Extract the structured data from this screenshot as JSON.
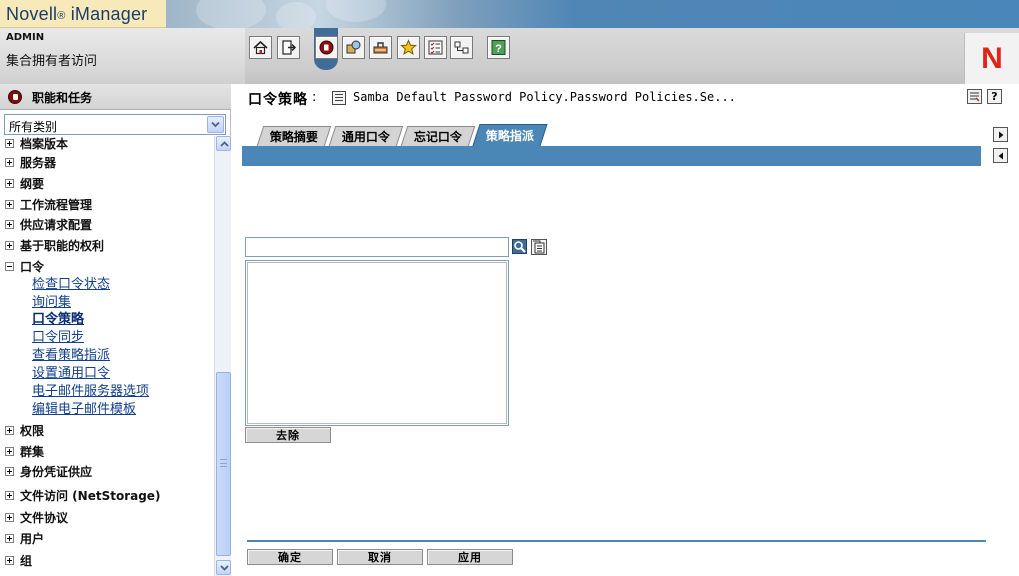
{
  "header": {
    "brand": "Novell",
    "brand_reg": "®",
    "product": " iManager",
    "user_name": "ADMIN",
    "user_role": "集合拥有者访问",
    "logo_letter": "N",
    "toolbar": [
      {
        "name": "home-icon"
      },
      {
        "name": "exit-icon"
      },
      {
        "name": "roles-tasks-icon"
      },
      {
        "name": "view-objects-icon"
      },
      {
        "name": "configure-icon"
      },
      {
        "name": "favorites-icon"
      },
      {
        "name": "preferences-icon"
      },
      {
        "name": "hierarchy-icon"
      },
      {
        "name": "help-icon"
      }
    ]
  },
  "sidebar": {
    "title": "职能和任务",
    "category_select": "所有类别",
    "categories_top": [
      {
        "label": "档案版本",
        "expanded": false
      },
      {
        "label": "服务器",
        "expanded": false
      },
      {
        "label": "纲要",
        "expanded": false
      },
      {
        "label": "工作流程管理",
        "expanded": false
      },
      {
        "label": "供应请求配置",
        "expanded": false
      },
      {
        "label": "基于职能的权利",
        "expanded": false
      },
      {
        "label": "口令",
        "expanded": true
      }
    ],
    "tasks": [
      {
        "label": "检查口令状态",
        "current": false
      },
      {
        "label": "询问集",
        "current": false
      },
      {
        "label": "口令策略",
        "current": true
      },
      {
        "label": "口令同步",
        "current": false
      },
      {
        "label": "查看策略指派",
        "current": false
      },
      {
        "label": "设置通用口令",
        "current": false
      },
      {
        "label": "电子邮件服务器选项",
        "current": false
      },
      {
        "label": "编辑电子邮件模板",
        "current": false
      }
    ],
    "categories_bottom": [
      {
        "label": "权限",
        "expanded": false
      },
      {
        "label": "群集",
        "expanded": false
      },
      {
        "label": "身份凭证供应",
        "expanded": false
      },
      {
        "label": "文件访问 (NetStorage)",
        "expanded": false
      },
      {
        "label": "文件协议",
        "expanded": false
      },
      {
        "label": "用户",
        "expanded": false
      },
      {
        "label": "组",
        "expanded": false
      }
    ]
  },
  "main": {
    "title": "口令策略",
    "colon": ":",
    "object_name": "Samba Default Password Policy.Password Policies.Se...",
    "tabs": [
      {
        "label": "策略摘要",
        "active": false
      },
      {
        "label": "通用口令",
        "active": false
      },
      {
        "label": "忘记口令",
        "active": false
      },
      {
        "label": "策略指派",
        "active": true
      }
    ],
    "search_value": "",
    "remove_button": "去除",
    "footer_buttons": {
      "ok": "确定",
      "cancel": "取消",
      "apply": "应用"
    }
  },
  "colors": {
    "tab_blue": "#4b87b6",
    "brand_yellow": "#f7e9b9",
    "novell_red": "#e2231a",
    "link_blue": "#12408c"
  }
}
